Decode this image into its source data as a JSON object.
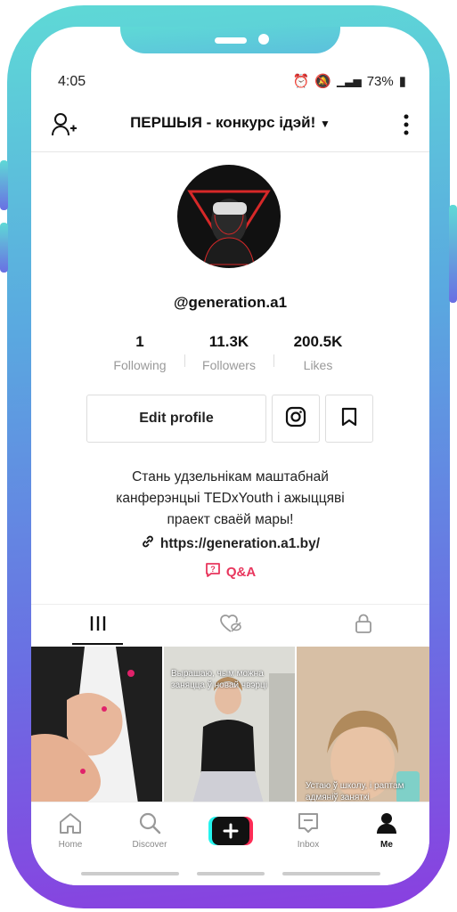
{
  "status_bar": {
    "time": "4:05",
    "battery": "73%"
  },
  "header": {
    "title": "ПЕРШЫЯ - конкурс ідэй!"
  },
  "profile": {
    "username": "@generation.a1",
    "stats": [
      {
        "value": "1",
        "label": "Following"
      },
      {
        "value": "11.3K",
        "label": "Followers"
      },
      {
        "value": "200.5K",
        "label": "Likes"
      }
    ],
    "edit_label": "Edit profile",
    "bio_lines": [
      "Стань удзельнікам маштабнай",
      "канферэнцыі TEDxYouth і ажыццяві",
      "праект сваёй мары!"
    ],
    "link": "https://generation.a1.by/",
    "qa_label": "Q&A"
  },
  "videos": [
    {
      "caption": ""
    },
    {
      "caption": "Вырашаю, чым можна заняцца ў новай чвэрці"
    },
    {
      "caption": "Устаю ў школу, і раптам адмяніў заняткі"
    }
  ],
  "nav": [
    {
      "label": "Home",
      "icon": "home-icon"
    },
    {
      "label": "Discover",
      "icon": "search-icon"
    },
    {
      "label": "",
      "icon": "create-icon"
    },
    {
      "label": "Inbox",
      "icon": "inbox-icon"
    },
    {
      "label": "Me",
      "icon": "profile-icon"
    }
  ],
  "colors": {
    "accent": "#e8365d",
    "frame_top": "#5ed9d6",
    "frame_bottom": "#8a3fe0"
  }
}
